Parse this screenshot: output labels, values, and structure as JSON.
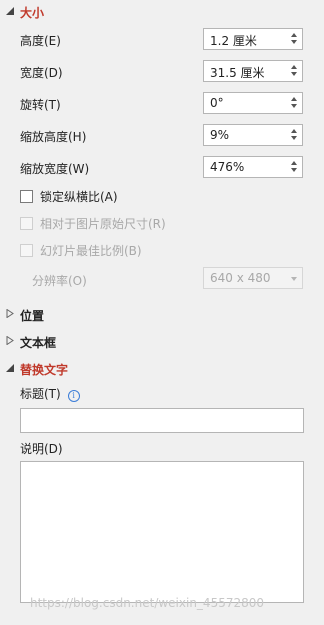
{
  "sections": {
    "size": {
      "title": "大小"
    },
    "position": {
      "title": "位置"
    },
    "textbox": {
      "title": "文本框"
    },
    "alt_text": {
      "title": "替换文字"
    }
  },
  "size": {
    "height_label": "高度(E)",
    "height_value": "1.2 厘米",
    "width_label": "宽度(D)",
    "width_value": "31.5 厘米",
    "rotation_label": "旋转(T)",
    "rotation_value": "0°",
    "scale_height_label": "缩放高度(H)",
    "scale_height_value": "9%",
    "scale_width_label": "缩放宽度(W)",
    "scale_width_value": "476%",
    "lock_aspect_label": "锁定纵横比(A)",
    "relative_original_label": "相对于图片原始尺寸(R)",
    "best_slideshow_label": "幻灯片最佳比例(B)",
    "resolution_label": "分辨率(O)",
    "resolution_value": "640 x 480"
  },
  "alt_text": {
    "title_label": "标题(T)",
    "title_value": "",
    "description_label": "说明(D)",
    "description_value": ""
  },
  "watermark": "https://blog.csdn.net/weixin_45572800",
  "colors": {
    "accent": "#c0392b",
    "panel_bg": "#f0f0f0"
  }
}
